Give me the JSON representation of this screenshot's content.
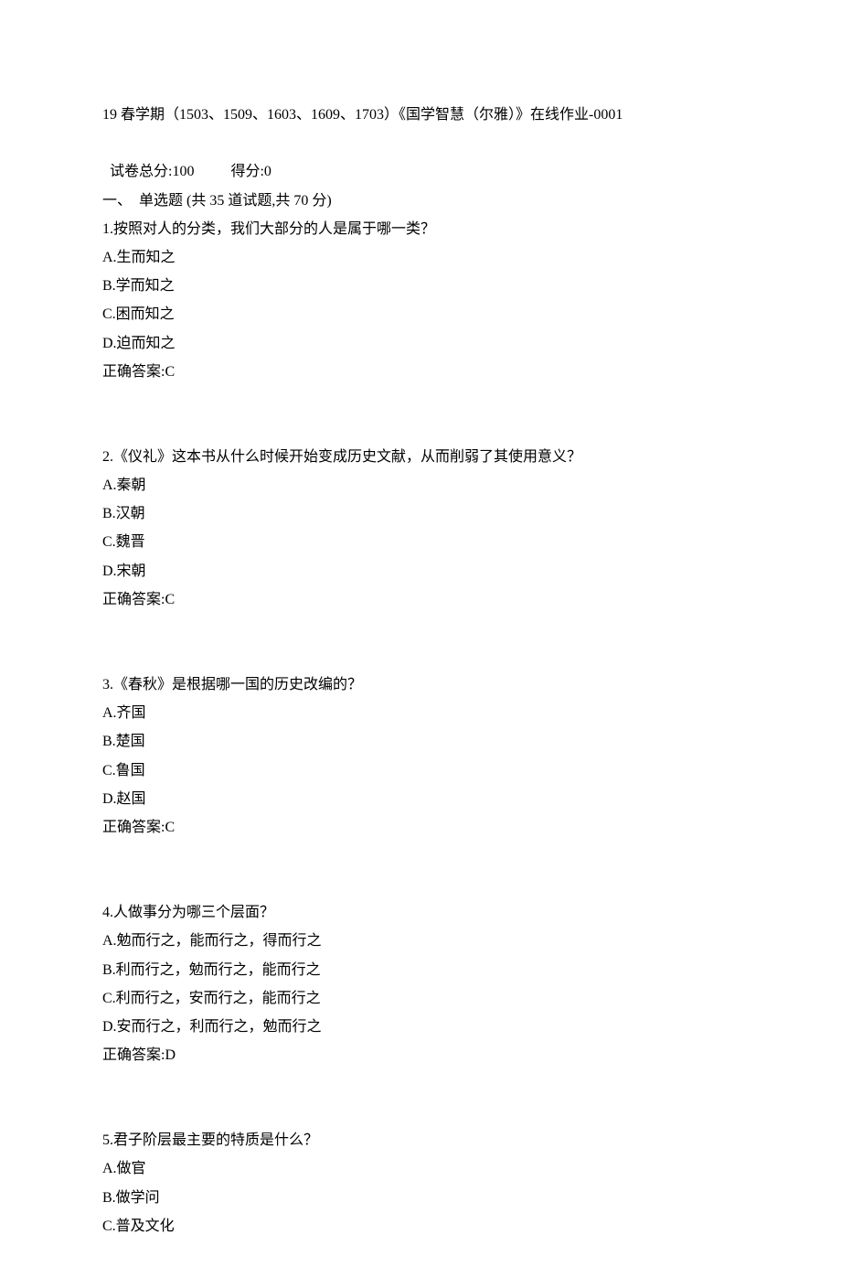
{
  "header": {
    "title_line": "19 春学期（1503、1509、1603、1609、1703）《国学智慧（尔雅）》在线作业-0001",
    "score_total_label": "试卷总分:100",
    "score_got_label": "得分:0",
    "section_title": "一、  单选题 (共 35 道试题,共 70 分)"
  },
  "questions": [
    {
      "stem": "1.按照对人的分类，我们大部分的人是属于哪一类？",
      "options": [
        "A.生而知之",
        "B.学而知之",
        "C.困而知之",
        "D.迫而知之"
      ],
      "answer": "正确答案:C"
    },
    {
      "stem": "2.《仪礼》这本书从什么时候开始变成历史文献，从而削弱了其使用意义？",
      "options": [
        "A.秦朝",
        "B.汉朝",
        "C.魏晋",
        "D.宋朝"
      ],
      "answer": "正确答案:C"
    },
    {
      "stem": "3.《春秋》是根据哪一国的历史改编的？",
      "options": [
        "A.齐国",
        "B.楚国",
        "C.鲁国",
        "D.赵国"
      ],
      "answer": "正确答案:C"
    },
    {
      "stem": "4.人做事分为哪三个层面？",
      "options": [
        "A.勉而行之，能而行之，得而行之",
        "B.利而行之，勉而行之，能而行之",
        "C.利而行之，安而行之，能而行之",
        "D.安而行之，利而行之，勉而行之"
      ],
      "answer": "正确答案:D"
    },
    {
      "stem": "5.君子阶层最主要的特质是什么？",
      "options": [
        "A.做官",
        "B.做学问",
        "C.普及文化"
      ],
      "answer": ""
    }
  ]
}
